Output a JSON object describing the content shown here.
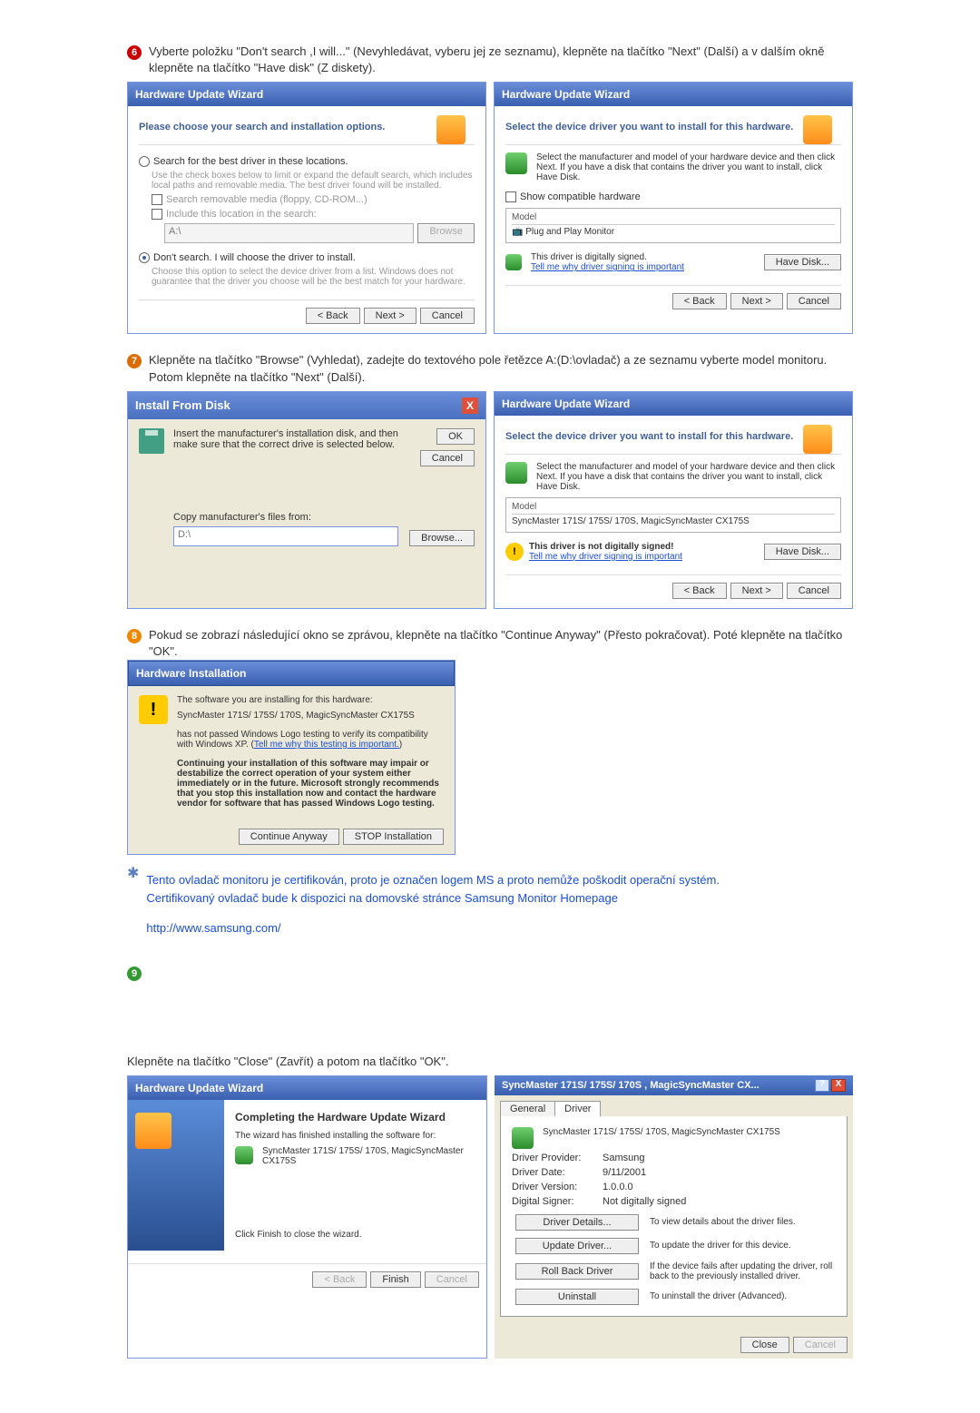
{
  "step6": {
    "instruction": "Vyberte položku \"Don't search ,I will...\" (Nevyhledávat, vyberu jej ze seznamu), klepněte na tlačítko \"Next\" (Další) a v dalším okně klepněte na tlačítko \"Have disk\" (Z diskety).",
    "left": {
      "title": "Hardware Update Wizard",
      "heading": "Please choose your search and installation options.",
      "opt1": "Search for the best driver in these locations.",
      "opt1_note": "Use the check boxes below to limit or expand the default search, which includes local paths and removable media. The best driver found will be installed.",
      "chk1": "Search removable media (floppy, CD-ROM...)",
      "chk2": "Include this location in the search:",
      "path": "A:\\",
      "browse": "Browse",
      "opt2": "Don't search. I will choose the driver to install.",
      "opt2_note": "Choose this option to select the device driver from a list. Windows does not guarantee that the driver you choose will be the best match for your hardware.",
      "back": "< Back",
      "next": "Next >",
      "cancel": "Cancel"
    },
    "right": {
      "title": "Hardware Update Wizard",
      "heading": "Select the device driver you want to install for this hardware.",
      "note": "Select the manufacturer and model of your hardware device and then click Next. If you have a disk that contains the driver you want to install, click Have Disk.",
      "show": "Show compatible hardware",
      "model_head": "Model",
      "model_item": "Plug and Play Monitor",
      "signed": "This driver is digitally signed.",
      "tellme": "Tell me why driver signing is important",
      "havedisk": "Have Disk...",
      "back": "< Back",
      "next": "Next >",
      "cancel": "Cancel"
    }
  },
  "step7": {
    "instruction": "Klepněte na tlačítko \"Browse\" (Vyhledat), zadejte do textového pole řetězce A:(D:\\ovladač) a ze seznamu vyberte model monitoru. Potom klepněte na tlačítko \"Next\" (Další).",
    "left": {
      "title": "Install From Disk",
      "msg": "Insert the manufacturer's installation disk, and then make sure that the correct drive is selected below.",
      "ok": "OK",
      "cancel": "Cancel",
      "copy": "Copy manufacturer's files from:",
      "path": "D:\\",
      "browse": "Browse..."
    },
    "right": {
      "title": "Hardware Update Wizard",
      "heading": "Select the device driver you want to install for this hardware.",
      "note": "Select the manufacturer and model of your hardware device and then click Next. If you have a disk that contains the driver you want to install, click Have Disk.",
      "model_head": "Model",
      "model_item": "SyncMaster 171S/ 175S/ 170S, MagicSyncMaster CX175S",
      "notsigned": "This driver is not digitally signed!",
      "tellme": "Tell me why driver signing is important",
      "havedisk": "Have Disk...",
      "back": "< Back",
      "next": "Next >",
      "cancel": "Cancel"
    }
  },
  "step8": {
    "instruction": "Pokud se zobrazí následující okno se zprávou, klepněte na tlačítko \"Continue Anyway\" (Přesto pokračovat). Poté klepněte na tlačítko \"OK\".",
    "dlg": {
      "title": "Hardware Installation",
      "l1": "The software you are installing for this hardware:",
      "l2": "SyncMaster 171S/ 175S/ 170S, MagicSyncMaster CX175S",
      "l3a": "has not passed Windows Logo testing to verify its compatibility with Windows XP. (",
      "l3link": "Tell me why this testing is important.",
      "l3b": ")",
      "l4": "Continuing your installation of this software may impair or destabilize the correct operation of your system either immediately or in the future. Microsoft strongly recommends that you stop this installation now and contact the hardware vendor for software that has passed Windows Logo testing.",
      "continue": "Continue Anyway",
      "stop": "STOP Installation"
    },
    "cert1": "Tento ovladač monitoru je certifikován, proto je označen logem MS a proto nemůže poškodit operační systém.",
    "cert2": "Certifikovaný ovladač bude k dispozici na domovské stránce Samsung Monitor Homepage",
    "url": "http://www.samsung.com/"
  },
  "step9": {
    "instruction": "Klepněte na tlačítko \"Close\" (Zavřít) a potom na tlačítko \"OK\".",
    "left": {
      "title": "Hardware Update Wizard",
      "heading": "Completing the Hardware Update Wizard",
      "msg": "The wizard has finished installing the software for:",
      "model": "SyncMaster 171S/ 175S/ 170S, MagicSyncMaster CX175S",
      "finishmsg": "Click Finish to close the wizard.",
      "back": "< Back",
      "finish": "Finish",
      "cancel": "Cancel"
    },
    "right": {
      "title": "SyncMaster 171S/ 175S/ 170S , MagicSyncMaster CX...",
      "tab1": "General",
      "tab2": "Driver",
      "model": "SyncMaster 171S/ 175S/ 170S, MagicSyncMaster CX175S",
      "lab_provider": "Driver Provider:",
      "val_provider": "Samsung",
      "lab_date": "Driver Date:",
      "val_date": "9/11/2001",
      "lab_version": "Driver Version:",
      "val_version": "1.0.0.0",
      "lab_signer": "Digital Signer:",
      "val_signer": "Not digitally signed",
      "b1": "Driver Details...",
      "d1": "To view details about the driver files.",
      "b2": "Update Driver...",
      "d2": "To update the driver for this device.",
      "b3": "Roll Back Driver",
      "d3": "If the device fails after updating the driver, roll back to the previously installed driver.",
      "b4": "Uninstall",
      "d4": "To uninstall the driver (Advanced).",
      "close": "Close",
      "cancel": "Cancel"
    }
  }
}
